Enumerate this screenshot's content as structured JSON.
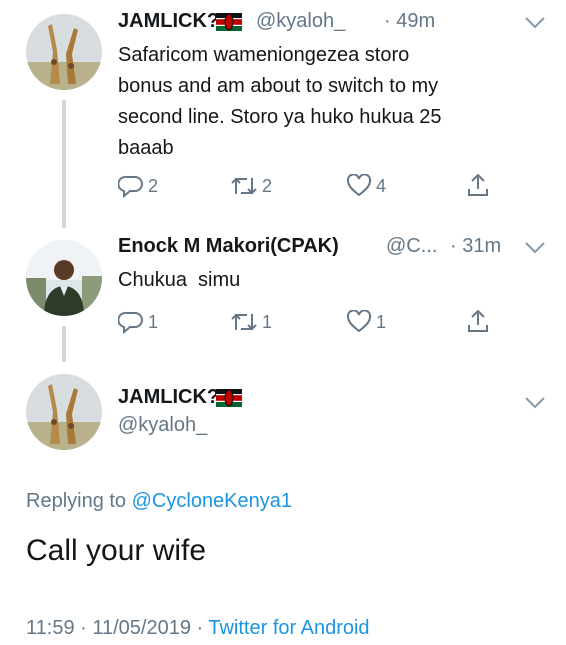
{
  "tweets": [
    {
      "name": "JAMLICK?",
      "handle": "@kyaloh_",
      "time": "· 49m",
      "text_lines": [
        "Safaricom wameniongezea storo",
        "bonus and am about to switch to my",
        "second line. Storo ya huko hukua 25",
        "baaab"
      ],
      "replies": "2",
      "retweets": "2",
      "likes": "4",
      "avatar": "giraffes-avatar"
    },
    {
      "name": "Enock M Makori(CPAK)",
      "handle": "@C...",
      "time": "· 31m",
      "text_lines": [
        "Chukua  simu"
      ],
      "replies": "1",
      "retweets": "1",
      "likes": "1",
      "avatar": "man-portrait-avatar"
    }
  ],
  "main_tweet": {
    "name": "JAMLICK?",
    "handle": "@kyaloh_",
    "replying_prefix": "Replying to",
    "replying_to": "@CycloneKenya1",
    "text": "Call your wife",
    "timestamp": "11:59 · 11/05/2019 ·",
    "source": "Twitter for Android",
    "avatar": "giraffes-avatar"
  },
  "icons": {
    "reply": "reply-icon",
    "retweet": "retweet-icon",
    "like": "heart-icon",
    "share": "share-icon",
    "more": "chevron-down-icon",
    "flag": "kenya-flag-icon"
  },
  "colors": {
    "text": "#14171a",
    "muted": "#657786",
    "link": "#1b95e0",
    "line": "#ccd6dd"
  }
}
